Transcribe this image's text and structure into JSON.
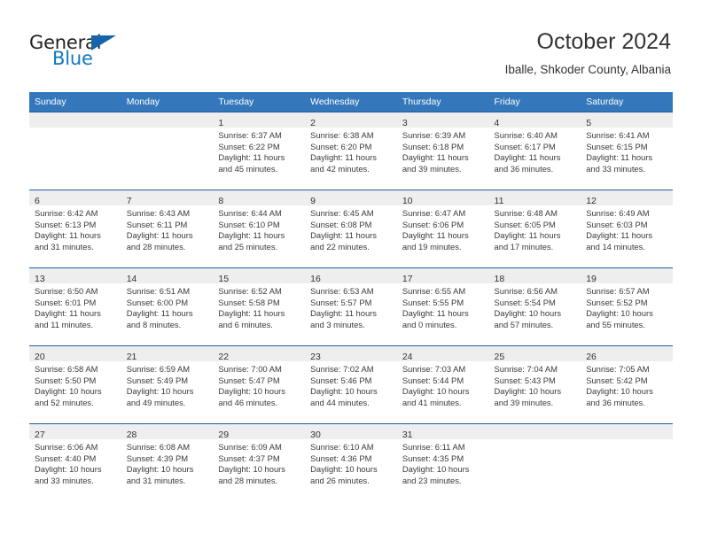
{
  "brand": {
    "word_one": "General",
    "word_two": "Blue",
    "triangle_color": "#1565a8",
    "blue_text_color": "#1278be"
  },
  "header": {
    "title": "October 2024",
    "subtitle": "Iballe, Shkoder County, Albania"
  },
  "theme": {
    "header_blue": "#3478bb",
    "row_rule_blue": "#1f5d9c",
    "daynum_band": "#eeeeee",
    "text": "#333333"
  },
  "weekday_headers": [
    "Sunday",
    "Monday",
    "Tuesday",
    "Wednesday",
    "Thursday",
    "Friday",
    "Saturday"
  ],
  "labels": {
    "sunrise_prefix": "Sunrise:",
    "sunset_prefix": "Sunset:",
    "daylight_prefix": "Daylight:"
  },
  "weeks": [
    [
      {
        "day": "",
        "sunrise": "",
        "sunset": "",
        "daylight_a": "",
        "daylight_b": ""
      },
      {
        "day": "",
        "sunrise": "",
        "sunset": "",
        "daylight_a": "",
        "daylight_b": ""
      },
      {
        "day": "1",
        "sunrise": "Sunrise: 6:37 AM",
        "sunset": "Sunset: 6:22 PM",
        "daylight_a": "Daylight: 11 hours",
        "daylight_b": "and 45 minutes."
      },
      {
        "day": "2",
        "sunrise": "Sunrise: 6:38 AM",
        "sunset": "Sunset: 6:20 PM",
        "daylight_a": "Daylight: 11 hours",
        "daylight_b": "and 42 minutes."
      },
      {
        "day": "3",
        "sunrise": "Sunrise: 6:39 AM",
        "sunset": "Sunset: 6:18 PM",
        "daylight_a": "Daylight: 11 hours",
        "daylight_b": "and 39 minutes."
      },
      {
        "day": "4",
        "sunrise": "Sunrise: 6:40 AM",
        "sunset": "Sunset: 6:17 PM",
        "daylight_a": "Daylight: 11 hours",
        "daylight_b": "and 36 minutes."
      },
      {
        "day": "5",
        "sunrise": "Sunrise: 6:41 AM",
        "sunset": "Sunset: 6:15 PM",
        "daylight_a": "Daylight: 11 hours",
        "daylight_b": "and 33 minutes."
      }
    ],
    [
      {
        "day": "6",
        "sunrise": "Sunrise: 6:42 AM",
        "sunset": "Sunset: 6:13 PM",
        "daylight_a": "Daylight: 11 hours",
        "daylight_b": "and 31 minutes."
      },
      {
        "day": "7",
        "sunrise": "Sunrise: 6:43 AM",
        "sunset": "Sunset: 6:11 PM",
        "daylight_a": "Daylight: 11 hours",
        "daylight_b": "and 28 minutes."
      },
      {
        "day": "8",
        "sunrise": "Sunrise: 6:44 AM",
        "sunset": "Sunset: 6:10 PM",
        "daylight_a": "Daylight: 11 hours",
        "daylight_b": "and 25 minutes."
      },
      {
        "day": "9",
        "sunrise": "Sunrise: 6:45 AM",
        "sunset": "Sunset: 6:08 PM",
        "daylight_a": "Daylight: 11 hours",
        "daylight_b": "and 22 minutes."
      },
      {
        "day": "10",
        "sunrise": "Sunrise: 6:47 AM",
        "sunset": "Sunset: 6:06 PM",
        "daylight_a": "Daylight: 11 hours",
        "daylight_b": "and 19 minutes."
      },
      {
        "day": "11",
        "sunrise": "Sunrise: 6:48 AM",
        "sunset": "Sunset: 6:05 PM",
        "daylight_a": "Daylight: 11 hours",
        "daylight_b": "and 17 minutes."
      },
      {
        "day": "12",
        "sunrise": "Sunrise: 6:49 AM",
        "sunset": "Sunset: 6:03 PM",
        "daylight_a": "Daylight: 11 hours",
        "daylight_b": "and 14 minutes."
      }
    ],
    [
      {
        "day": "13",
        "sunrise": "Sunrise: 6:50 AM",
        "sunset": "Sunset: 6:01 PM",
        "daylight_a": "Daylight: 11 hours",
        "daylight_b": "and 11 minutes."
      },
      {
        "day": "14",
        "sunrise": "Sunrise: 6:51 AM",
        "sunset": "Sunset: 6:00 PM",
        "daylight_a": "Daylight: 11 hours",
        "daylight_b": "and 8 minutes."
      },
      {
        "day": "15",
        "sunrise": "Sunrise: 6:52 AM",
        "sunset": "Sunset: 5:58 PM",
        "daylight_a": "Daylight: 11 hours",
        "daylight_b": "and 6 minutes."
      },
      {
        "day": "16",
        "sunrise": "Sunrise: 6:53 AM",
        "sunset": "Sunset: 5:57 PM",
        "daylight_a": "Daylight: 11 hours",
        "daylight_b": "and 3 minutes."
      },
      {
        "day": "17",
        "sunrise": "Sunrise: 6:55 AM",
        "sunset": "Sunset: 5:55 PM",
        "daylight_a": "Daylight: 11 hours",
        "daylight_b": "and 0 minutes."
      },
      {
        "day": "18",
        "sunrise": "Sunrise: 6:56 AM",
        "sunset": "Sunset: 5:54 PM",
        "daylight_a": "Daylight: 10 hours",
        "daylight_b": "and 57 minutes."
      },
      {
        "day": "19",
        "sunrise": "Sunrise: 6:57 AM",
        "sunset": "Sunset: 5:52 PM",
        "daylight_a": "Daylight: 10 hours",
        "daylight_b": "and 55 minutes."
      }
    ],
    [
      {
        "day": "20",
        "sunrise": "Sunrise: 6:58 AM",
        "sunset": "Sunset: 5:50 PM",
        "daylight_a": "Daylight: 10 hours",
        "daylight_b": "and 52 minutes."
      },
      {
        "day": "21",
        "sunrise": "Sunrise: 6:59 AM",
        "sunset": "Sunset: 5:49 PM",
        "daylight_a": "Daylight: 10 hours",
        "daylight_b": "and 49 minutes."
      },
      {
        "day": "22",
        "sunrise": "Sunrise: 7:00 AM",
        "sunset": "Sunset: 5:47 PM",
        "daylight_a": "Daylight: 10 hours",
        "daylight_b": "and 46 minutes."
      },
      {
        "day": "23",
        "sunrise": "Sunrise: 7:02 AM",
        "sunset": "Sunset: 5:46 PM",
        "daylight_a": "Daylight: 10 hours",
        "daylight_b": "and 44 minutes."
      },
      {
        "day": "24",
        "sunrise": "Sunrise: 7:03 AM",
        "sunset": "Sunset: 5:44 PM",
        "daylight_a": "Daylight: 10 hours",
        "daylight_b": "and 41 minutes."
      },
      {
        "day": "25",
        "sunrise": "Sunrise: 7:04 AM",
        "sunset": "Sunset: 5:43 PM",
        "daylight_a": "Daylight: 10 hours",
        "daylight_b": "and 39 minutes."
      },
      {
        "day": "26",
        "sunrise": "Sunrise: 7:05 AM",
        "sunset": "Sunset: 5:42 PM",
        "daylight_a": "Daylight: 10 hours",
        "daylight_b": "and 36 minutes."
      }
    ],
    [
      {
        "day": "27",
        "sunrise": "Sunrise: 6:06 AM",
        "sunset": "Sunset: 4:40 PM",
        "daylight_a": "Daylight: 10 hours",
        "daylight_b": "and 33 minutes."
      },
      {
        "day": "28",
        "sunrise": "Sunrise: 6:08 AM",
        "sunset": "Sunset: 4:39 PM",
        "daylight_a": "Daylight: 10 hours",
        "daylight_b": "and 31 minutes."
      },
      {
        "day": "29",
        "sunrise": "Sunrise: 6:09 AM",
        "sunset": "Sunset: 4:37 PM",
        "daylight_a": "Daylight: 10 hours",
        "daylight_b": "and 28 minutes."
      },
      {
        "day": "30",
        "sunrise": "Sunrise: 6:10 AM",
        "sunset": "Sunset: 4:36 PM",
        "daylight_a": "Daylight: 10 hours",
        "daylight_b": "and 26 minutes."
      },
      {
        "day": "31",
        "sunrise": "Sunrise: 6:11 AM",
        "sunset": "Sunset: 4:35 PM",
        "daylight_a": "Daylight: 10 hours",
        "daylight_b": "and 23 minutes."
      },
      {
        "day": "",
        "sunrise": "",
        "sunset": "",
        "daylight_a": "",
        "daylight_b": ""
      },
      {
        "day": "",
        "sunrise": "",
        "sunset": "",
        "daylight_a": "",
        "daylight_b": ""
      }
    ]
  ]
}
